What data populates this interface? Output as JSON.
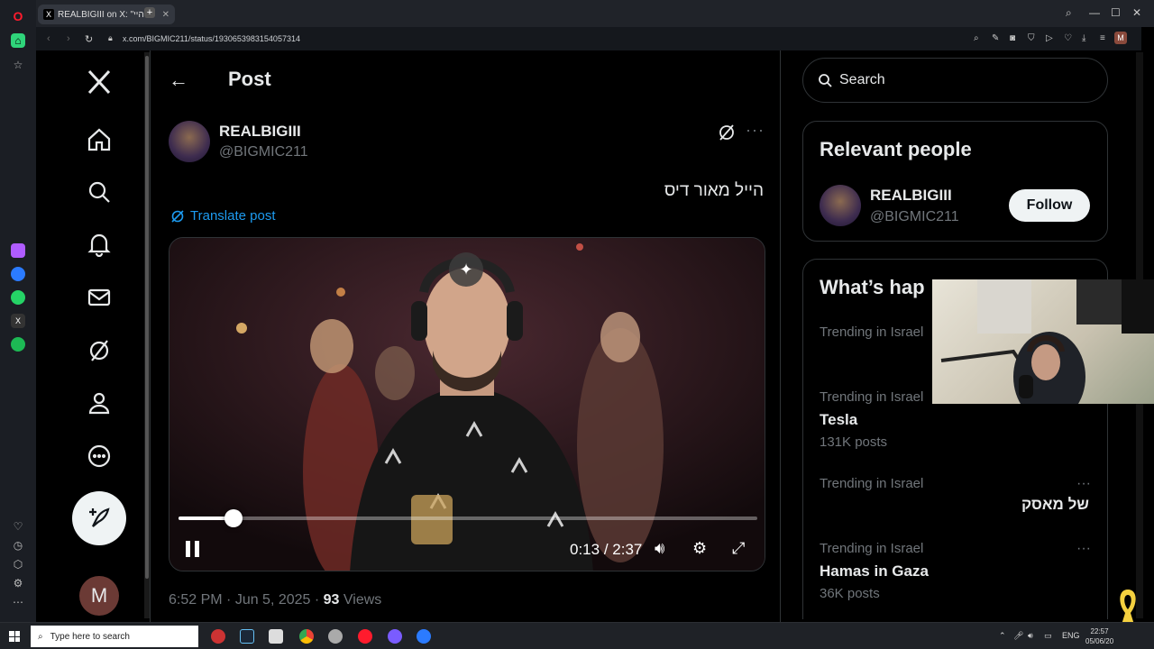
{
  "browser": {
    "tab_title": "REALBIGIII on X: \"היי\"",
    "tab_close": "✕",
    "new_tab": "+",
    "url": "x.com/BIGMIC211/status/1930653983154057314"
  },
  "nav": {
    "logo": "𝕏",
    "account_initial": "M"
  },
  "post": {
    "header_title": "Post",
    "author_name": "REALBIGIII",
    "author_handle": "@BIGMIC211",
    "more": "···",
    "text": "הייל מאור דיס",
    "translate_label": "Translate post",
    "video": {
      "current_time": "0:13",
      "duration": "2:37",
      "time_separator": " / ",
      "progress_fraction": 0.095
    },
    "time": "6:52 PM",
    "date": "Jun 5, 2025",
    "views_count": "93",
    "views_label": "Views",
    "separator": " · "
  },
  "sidebar": {
    "search_placeholder": "Search",
    "relevant_people_title": "Relevant people",
    "person": {
      "name": "REALBIGIII",
      "handle": "@BIGMIC211",
      "follow_label": "Follow"
    },
    "whats_happening_title": "What’s hap",
    "trends": [
      {
        "context": "Trending in Israel",
        "name": "",
        "count": ""
      },
      {
        "context": "Trending in Israel",
        "name": "Tesla",
        "count": "131K posts"
      },
      {
        "context": "Trending in Israel",
        "name": "של מאסק",
        "count": ""
      },
      {
        "context": "Trending in Israel",
        "name": "Hamas in Gaza",
        "count": "36K posts"
      }
    ],
    "more": "···"
  },
  "taskbar": {
    "search_placeholder": "Type here to search",
    "lang": "ENG",
    "time": "22:57",
    "date": "05/06/20"
  },
  "colors": {
    "accent_blue": "#1d9bf0",
    "background": "#000000",
    "border": "#2f3336",
    "muted_text": "#71767b"
  }
}
